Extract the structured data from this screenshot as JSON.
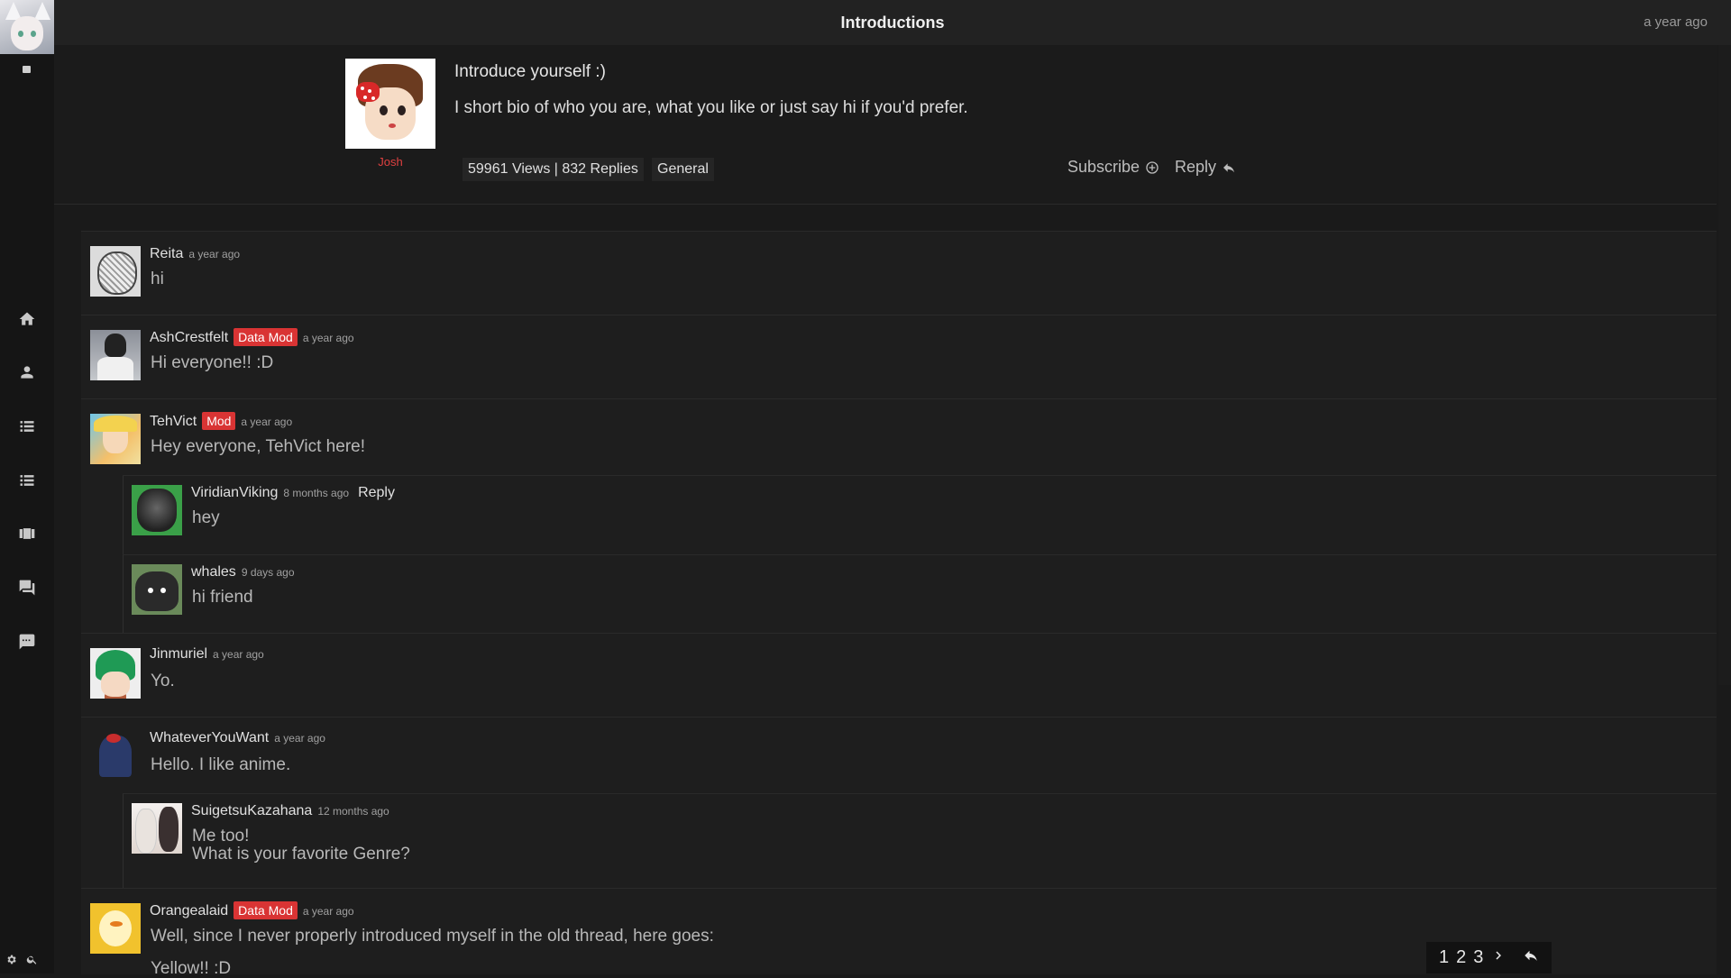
{
  "topbar": {
    "title": "Introductions",
    "time": "a year ago"
  },
  "sidebar": {
    "icons": [
      "home-icon",
      "user-icon",
      "list-icon",
      "list-alt-icon",
      "library-icon",
      "forum-icon",
      "chat-icon"
    ],
    "bottom": [
      "settings-icon",
      "search-icon"
    ]
  },
  "op": {
    "author": "Josh",
    "title": "Introduce yourself :)",
    "body": "I short bio of who you are, what you like or just say hi if you'd prefer.",
    "stats": "59961 Views | 832 Replies",
    "category": "General",
    "subscribe_label": "Subscribe",
    "reply_label": "Reply"
  },
  "comments": [
    {
      "author": "Reita",
      "time": "a year ago",
      "text": "hi"
    },
    {
      "author": "AshCrestfelt",
      "badge": "Data Mod",
      "time": "a year ago",
      "text": "Hi everyone!! :D"
    },
    {
      "author": "TehVict",
      "badge": "Mod",
      "time": "a year ago",
      "text": "Hey everyone, TehVict here!"
    },
    {
      "author": "ViridianViking",
      "time": "8 months ago",
      "reply": "Reply",
      "text": "hey"
    },
    {
      "author": "whales",
      "time": "9 days ago",
      "text": "hi friend"
    },
    {
      "author": "Jinmuriel",
      "time": "a year ago",
      "text": "Yo."
    },
    {
      "author": "WhateverYouWant",
      "time": "a year ago",
      "text": "Hello. I like anime."
    },
    {
      "author": "SuigetsuKazahana",
      "time": "12 months ago",
      "text": "Me too!",
      "text2": "What is your favorite Genre?"
    },
    {
      "author": "Orangealaid",
      "badge": "Data Mod",
      "time": "a year ago",
      "text": "Well, since I never properly introduced myself in the old thread, here goes:",
      "text2": "Yellow!! :D"
    }
  ],
  "pager": {
    "p1": "1",
    "p2": "2",
    "p3": "3"
  },
  "colors": {
    "badge": "#d93434",
    "author_op": "#e04040"
  }
}
